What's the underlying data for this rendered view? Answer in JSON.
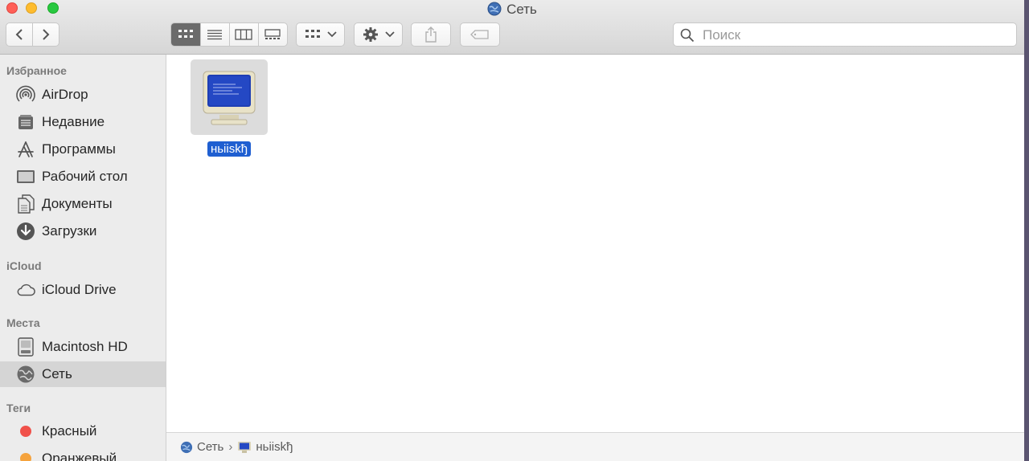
{
  "window": {
    "title": "Сеть"
  },
  "toolbar": {
    "view_modes": [
      "icon-view",
      "list-view",
      "column-view",
      "gallery-view"
    ],
    "active_view": "icon-view",
    "group_menu": "grid-icon",
    "action_menu": "gear-icon"
  },
  "search": {
    "placeholder": "Поиск",
    "value": ""
  },
  "sidebar": {
    "favorites_title": "Избранное",
    "favorites": [
      {
        "label": "AirDrop",
        "icon": "airdrop-icon"
      },
      {
        "label": "Недавние",
        "icon": "recents-icon"
      },
      {
        "label": "Программы",
        "icon": "applications-icon"
      },
      {
        "label": "Рабочий стол",
        "icon": "desktop-icon"
      },
      {
        "label": "Документы",
        "icon": "documents-icon"
      },
      {
        "label": "Загрузки",
        "icon": "downloads-icon"
      }
    ],
    "icloud_title": "iCloud",
    "icloud": [
      {
        "label": "iCloud Drive",
        "icon": "cloud-icon"
      }
    ],
    "locations_title": "Места",
    "locations": [
      {
        "label": "Macintosh HD",
        "icon": "disk-icon"
      },
      {
        "label": "Сеть",
        "icon": "network-icon",
        "selected": true
      }
    ],
    "tags_title": "Теги",
    "tags": [
      {
        "label": "Красный",
        "color": "#f0514a"
      },
      {
        "label": "Оранжевый",
        "color": "#f5a33d"
      }
    ]
  },
  "content": {
    "items": [
      {
        "name": "ньiiskђ",
        "icon": "computer-monitor-icon",
        "selected": true
      }
    ]
  },
  "pathbar": {
    "segments": [
      "Сеть",
      "ньiiskђ"
    ]
  },
  "colors": {
    "selection_blue": "#1f5fd1",
    "sidebar_bg": "#ececec",
    "tag_red": "#f0514a",
    "tag_orange": "#f5a33d"
  }
}
